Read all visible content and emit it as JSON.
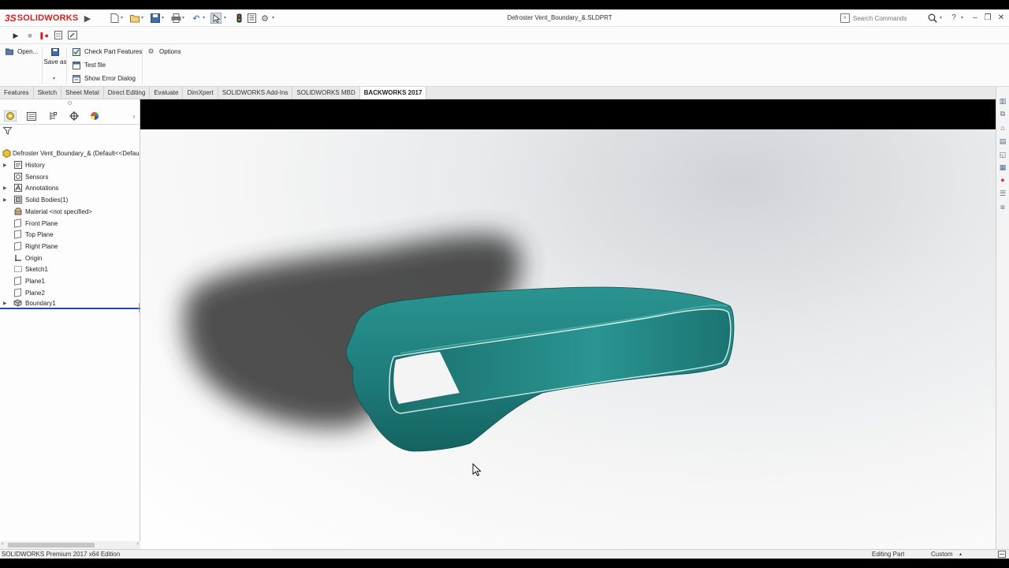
{
  "app": {
    "logo_ds": "3S",
    "logo_text": "SOLIDWORKS",
    "document_title": "Defroster Vent_Boundary_&.SLDPRT",
    "search_placeholder": "Search Commands",
    "help_label": "?"
  },
  "ribbon": {
    "open_label": "Open...",
    "save_as_label": "Save as",
    "check_part_label": "Check Part Features",
    "test_file_label": "Test file",
    "show_error_label": "Show Error Dialog",
    "options_label": "Options"
  },
  "tabs": [
    {
      "label": "Features"
    },
    {
      "label": "Sketch"
    },
    {
      "label": "Sheet Metal"
    },
    {
      "label": "Direct Editing"
    },
    {
      "label": "Evaluate"
    },
    {
      "label": "DimXpert"
    },
    {
      "label": "SOLIDWORKS Add-Ins"
    },
    {
      "label": "SOLIDWORKS MBD"
    },
    {
      "label": "BACKWORKS 2017"
    }
  ],
  "tree": {
    "root": "Defroster Vent_Boundary_&  (Default<<Defau",
    "items": [
      {
        "label": "History",
        "icon": "history-icon"
      },
      {
        "label": "Sensors",
        "icon": "sensors-icon"
      },
      {
        "label": "Annotations",
        "icon": "annotations-icon"
      },
      {
        "label": "Solid Bodies(1)",
        "icon": "solid-bodies-icon"
      },
      {
        "label": "Material <not specified>",
        "icon": "material-icon"
      },
      {
        "label": "Front Plane",
        "icon": "plane-icon"
      },
      {
        "label": "Top Plane",
        "icon": "plane-icon"
      },
      {
        "label": "Right Plane",
        "icon": "plane-icon"
      },
      {
        "label": "Origin",
        "icon": "origin-icon"
      },
      {
        "label": "Sketch1",
        "icon": "sketch-icon"
      },
      {
        "label": "Plane1",
        "icon": "plane-icon"
      },
      {
        "label": "Plane2",
        "icon": "plane-icon"
      },
      {
        "label": "Boundary1",
        "icon": "boundary-icon"
      }
    ]
  },
  "status": {
    "edition": "SOLIDWORKS Premium 2017 x64 Edition",
    "mode": "Editing Part",
    "units": "Custom"
  },
  "colors": {
    "model": "#1f7f7d",
    "shadow": "#3a3a3a",
    "brand_red": "#d32020"
  }
}
